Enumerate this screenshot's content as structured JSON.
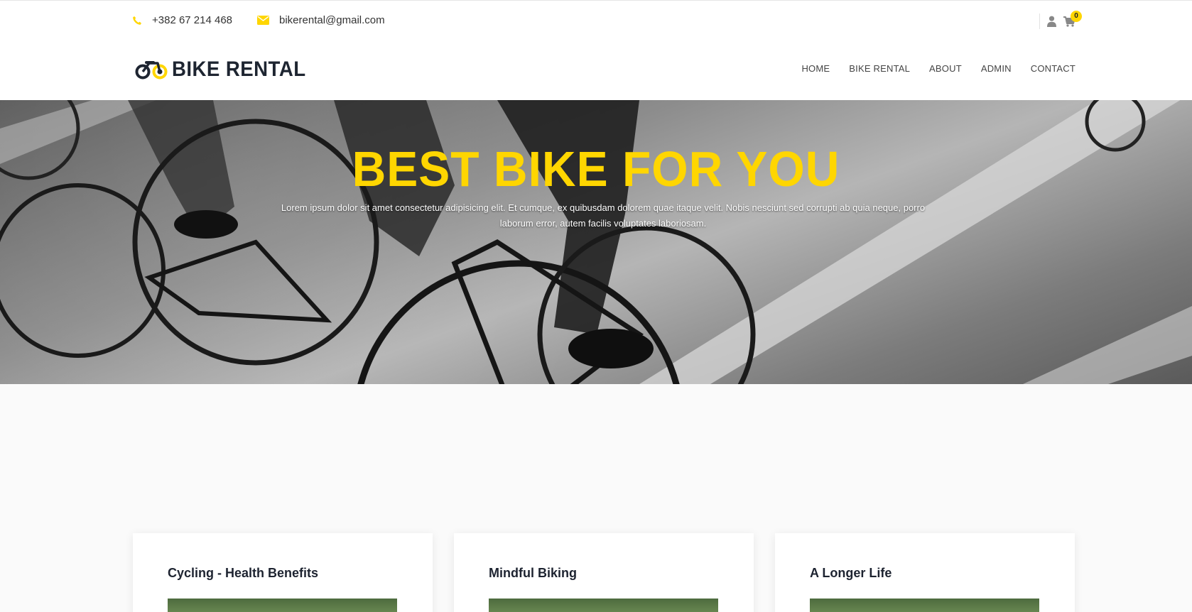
{
  "topbar": {
    "phone": "+382 67 214 468",
    "email": "bikerental@gmail.com",
    "cart_count": "0"
  },
  "header": {
    "logo_text": "BIKE RENTAL",
    "nav": [
      {
        "label": "HOME"
      },
      {
        "label": "BIKE RENTAL"
      },
      {
        "label": "ABOUT"
      },
      {
        "label": "ADMIN"
      },
      {
        "label": "CONTACT"
      }
    ]
  },
  "hero": {
    "title": "BEST BIKE FOR YOU",
    "subtitle": "Lorem ipsum dolor sit amet consectetur adipisicing elit. Et cumque, ex quibusdam dolorem quae itaque velit. Nobis nesciunt sed corrupti ab quia neque, porro laborum error, autem facilis voluptates laboriosam."
  },
  "cards": [
    {
      "title": "Cycling - Health Benefits"
    },
    {
      "title": "Mindful Biking"
    },
    {
      "title": "A Longer Life"
    }
  ],
  "colors": {
    "accent": "#ffd600",
    "dark": "#1e2531"
  }
}
